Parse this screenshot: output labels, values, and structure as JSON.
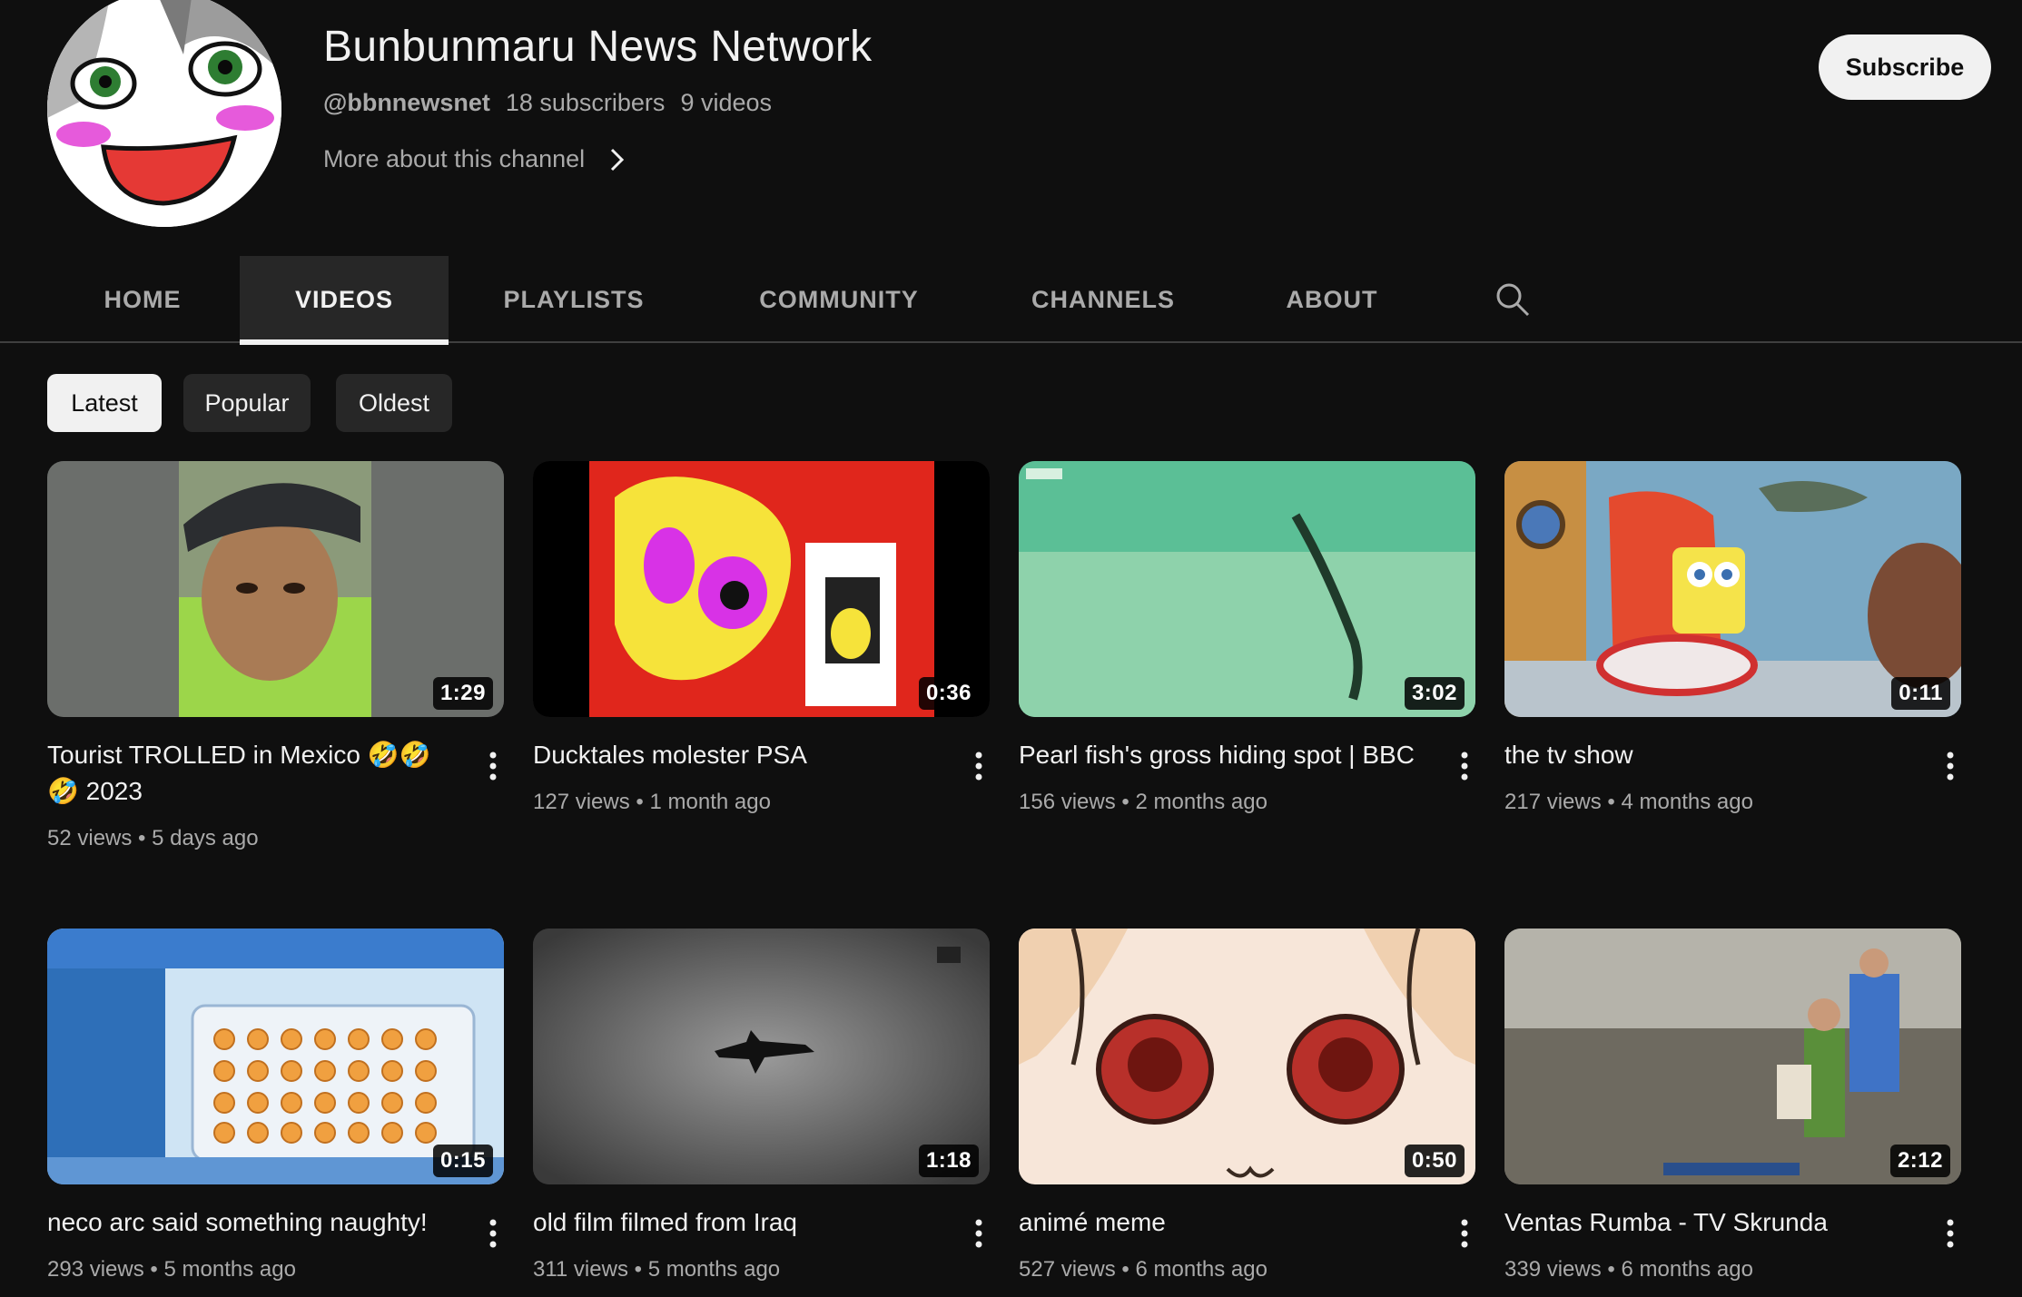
{
  "channel": {
    "name": "Bunbunmaru News Network",
    "handle": "@bbnnewsnet",
    "subscribers": "18 subscribers",
    "videos_count": "9 videos",
    "more_about": "More about this channel",
    "subscribe_label": "Subscribe"
  },
  "tabs": [
    {
      "label": "HOME",
      "active": false
    },
    {
      "label": "VIDEOS",
      "active": true
    },
    {
      "label": "PLAYLISTS",
      "active": false
    },
    {
      "label": "COMMUNITY",
      "active": false
    },
    {
      "label": "CHANNELS",
      "active": false
    },
    {
      "label": "ABOUT",
      "active": false
    }
  ],
  "chips": [
    {
      "label": "Latest",
      "active": true
    },
    {
      "label": "Popular",
      "active": false
    },
    {
      "label": "Oldest",
      "active": false
    }
  ],
  "videos": [
    {
      "title": "Tourist TROLLED in Mexico 🤣🤣🤣 2023",
      "views": "52 views",
      "age": "5 days ago",
      "duration": "1:29"
    },
    {
      "title": "Ducktales molester PSA",
      "views": "127 views",
      "age": "1 month ago",
      "duration": "0:36"
    },
    {
      "title": "Pearl fish's gross hiding spot | BBC",
      "views": "156 views",
      "age": "2 months ago",
      "duration": "3:02"
    },
    {
      "title": "the tv show",
      "views": "217 views",
      "age": "4 months ago",
      "duration": "0:11"
    },
    {
      "title": "neco arc said something naughty!",
      "views": "293 views",
      "age": "5 months ago",
      "duration": "0:15"
    },
    {
      "title": "old film filmed from Iraq",
      "views": "311 views",
      "age": "5 months ago",
      "duration": "1:18"
    },
    {
      "title": "animé meme",
      "views": "527 views",
      "age": "6 months ago",
      "duration": "0:50"
    },
    {
      "title": "Ventas Rumba - TV Skrunda",
      "views": "339 views",
      "age": "6 months ago",
      "duration": "2:12"
    }
  ],
  "icons": {
    "more_about": "chevron-right-icon",
    "search": "search-icon",
    "video_menu": "more-vertical-icon"
  },
  "colors": {
    "background": "#0f0f0f",
    "text_primary": "#f1f1f1",
    "text_secondary": "#aaaaaa",
    "chip_background": "#272727",
    "active_tab_underline": "#f1f1f1"
  }
}
